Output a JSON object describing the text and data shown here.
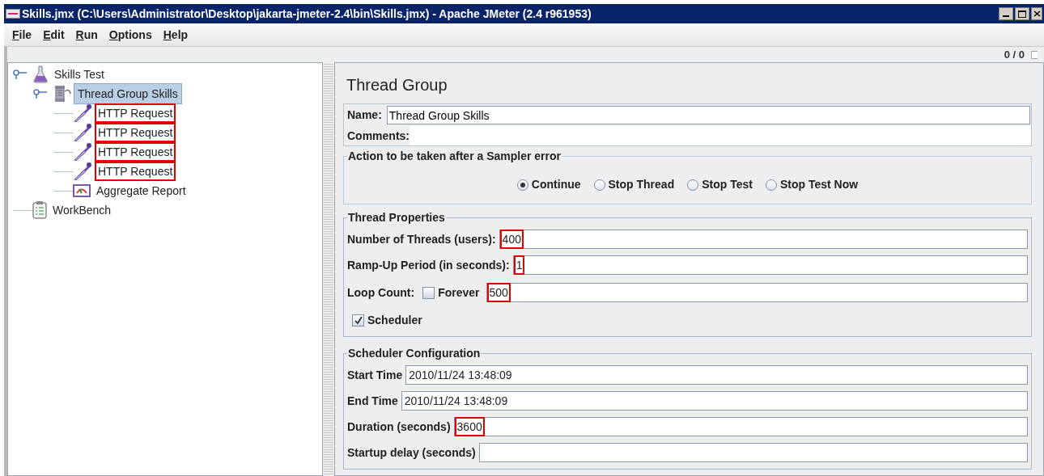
{
  "window": {
    "title": "Skills.jmx (C:\\Users\\Administrator\\Desktop\\jakarta-jmeter-2.4\\bin\\Skills.jmx) - Apache JMeter (2.4 r961953)"
  },
  "menu": [
    "File",
    "Edit",
    "Run",
    "Options",
    "Help"
  ],
  "toolbar": {
    "counter": "0 / 0"
  },
  "tree": [
    {
      "label": "Skills Test",
      "kind": "test-plan",
      "selected": false,
      "highlighted": false,
      "expanded": true,
      "children": [
        {
          "label": "Thread Group Skills",
          "kind": "thread-group",
          "selected": true,
          "highlighted": false,
          "expanded": true,
          "children": [
            {
              "label": "HTTP Request",
              "kind": "sampler",
              "selected": false,
              "highlighted": true
            },
            {
              "label": "HTTP Request",
              "kind": "sampler",
              "selected": false,
              "highlighted": true
            },
            {
              "label": "HTTP Request",
              "kind": "sampler",
              "selected": false,
              "highlighted": true
            },
            {
              "label": "HTTP Request",
              "kind": "sampler",
              "selected": false,
              "highlighted": true
            },
            {
              "label": "Aggregate Report",
              "kind": "listener",
              "selected": false,
              "highlighted": false
            }
          ]
        }
      ]
    },
    {
      "label": "WorkBench",
      "kind": "workbench",
      "selected": false,
      "highlighted": false
    }
  ],
  "editor": {
    "title": "Thread Group",
    "name": {
      "label": "Name:",
      "value": "Thread Group Skills"
    },
    "comments": {
      "label": "Comments:"
    },
    "sampler_error": {
      "title": "Action to be taken after a Sampler error",
      "options": [
        {
          "label": "Continue",
          "selected": true
        },
        {
          "label": "Stop Thread",
          "selected": false
        },
        {
          "label": "Stop Test",
          "selected": false
        },
        {
          "label": "Stop Test Now",
          "selected": false
        }
      ]
    },
    "thread_properties": {
      "title": "Thread Properties",
      "fields": [
        {
          "label": "Number of Threads (users):",
          "value": "400",
          "highlighted": true
        },
        {
          "label": "Ramp-Up Period (in seconds):",
          "value": "1",
          "highlighted": true
        },
        {
          "label": "Loop Count:",
          "value": "500",
          "highlighted": true,
          "checkbox": {
            "label": "Forever",
            "checked": false
          }
        }
      ],
      "scheduler": {
        "label": "Scheduler",
        "checked": true
      }
    },
    "scheduler_configuration": {
      "title": "Scheduler Configuration",
      "fields": [
        {
          "label": "Start Time",
          "value": "2010/11/24 13:48:09",
          "highlighted": false
        },
        {
          "label": "End Time",
          "value": "2010/11/24 13:48:09",
          "highlighted": false
        },
        {
          "label": "Duration (seconds)",
          "value": "3600",
          "highlighted": true
        },
        {
          "label": "Startup delay (seconds)",
          "highlighted": false
        }
      ]
    }
  }
}
